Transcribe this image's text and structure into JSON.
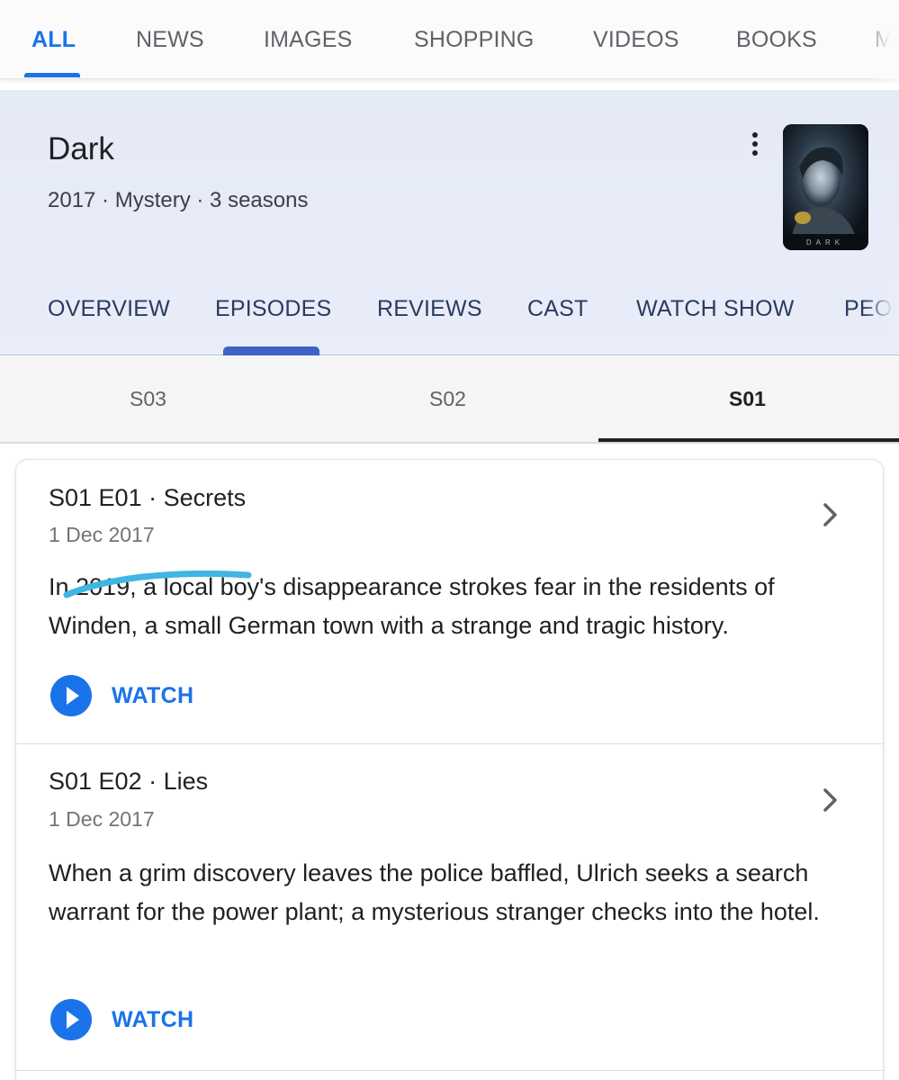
{
  "search_tabs": [
    {
      "label": "ALL",
      "active": true
    },
    {
      "label": "NEWS"
    },
    {
      "label": "IMAGES"
    },
    {
      "label": "SHOPPING"
    },
    {
      "label": "VIDEOS"
    },
    {
      "label": "BOOKS"
    },
    {
      "label": "M"
    }
  ],
  "show": {
    "title": "Dark",
    "meta": "2017 · Mystery · 3 seasons",
    "poster_text": "DARK"
  },
  "kp_tabs": [
    {
      "label": "OVERVIEW"
    },
    {
      "label": "EPISODES",
      "active": true
    },
    {
      "label": "REVIEWS"
    },
    {
      "label": "CAST"
    },
    {
      "label": "WATCH SHOW"
    },
    {
      "label": "PEOP"
    }
  ],
  "season_tabs": [
    {
      "label": "S03"
    },
    {
      "label": "S02"
    },
    {
      "label": "S01",
      "active": true
    }
  ],
  "episodes": [
    {
      "title": "S01 E01 · Secrets",
      "date": "1 Dec 2017",
      "description": "In 2019, a local boy's disappearance strokes fear in the residents of Winden, a small German town with a strange and tragic history.",
      "watch_label": "WATCH"
    },
    {
      "title": "S01 E02 · Lies",
      "date": "1 Dec 2017",
      "description": "When a grim discovery leaves the police baffled, Ulrich seeks a search warrant for the power plant; a mysterious stranger checks into the hotel.",
      "watch_label": "WATCH"
    }
  ],
  "colors": {
    "accent": "#1a73e8",
    "header_bg": "#e7ebf8",
    "scribble": "#3fb6e3"
  }
}
